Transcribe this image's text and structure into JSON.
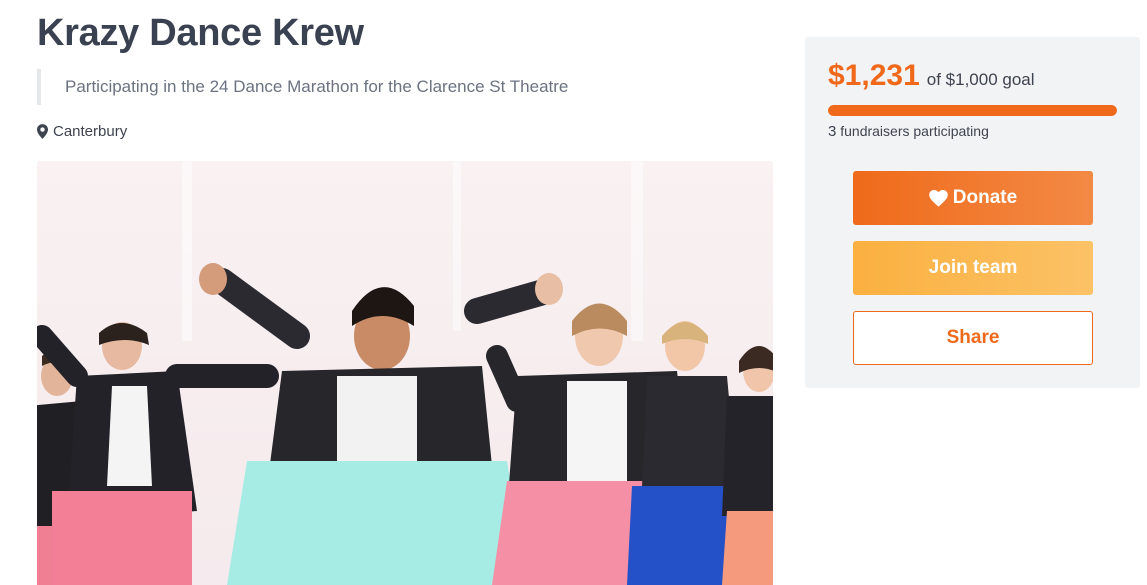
{
  "header": {
    "title": "Krazy Dance Krew",
    "description": "Participating in the 24 Dance Marathon for the Clarence St Theatre",
    "location": "Canterbury",
    "location_icon": "map-marker-icon"
  },
  "hero": {
    "image_subject": "group of young dancers in black leather jackets and colorful pants"
  },
  "sidebar": {
    "raised": "$1,231",
    "goal_text": "of $1,000 goal",
    "progress_fraction": 1.0,
    "fundraiser_count": "3",
    "fundraiser_text": "fundraisers participating",
    "donate_label": "Donate",
    "donate_icon": "heart-icon",
    "join_label": "Join team",
    "share_label": "Share"
  },
  "colors": {
    "accent": "#f0691a",
    "join": "#fbb040",
    "panel_bg": "#f2f3f5",
    "title": "#3a4150"
  }
}
